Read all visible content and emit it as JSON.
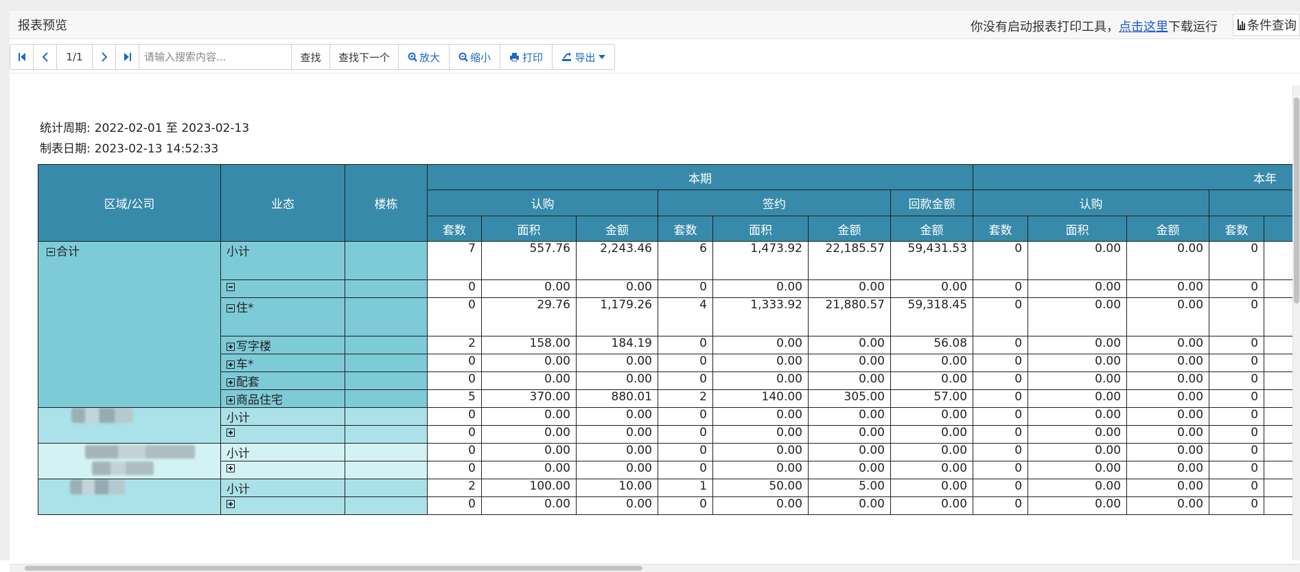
{
  "window": {
    "title": "报表预览"
  },
  "notice": {
    "text": "你没有启动报表打印工具，",
    "link": "点击这里",
    "suffix": "下载运行"
  },
  "query_button": "条件查询",
  "toolbar": {
    "page": "1/1",
    "search_placeholder": "请输入搜索内容...",
    "find": "查找",
    "find_next": "查找下一个",
    "zoom_in": "放大",
    "zoom_out": "缩小",
    "print": "打印",
    "export": "导出"
  },
  "meta": {
    "period_label": "统计周期:",
    "period_value": "2022-02-01 至 2023-02-13",
    "date_label": "制表日期:",
    "date_value": "2023-02-13 14:52:33"
  },
  "table": {
    "headers": {
      "region": "区域/公司",
      "type": "业态",
      "building": "楼栋",
      "current": "本期",
      "year": "本年",
      "subscribe": "认购",
      "sign": "签约",
      "payback": "回款金额",
      "subscribe_year": "认购",
      "sub": [
        "套数",
        "面积",
        "金额",
        "套数",
        "面积",
        "金额",
        "金额",
        "套数",
        "面积",
        "金额",
        "套数"
      ]
    },
    "group_total": "合计",
    "rows": [
      {
        "type": "小计",
        "values": [
          "7",
          "557.76",
          "2,243.46",
          "6",
          "1,473.92",
          "22,185.57",
          "59,431.53",
          "0",
          "0.00",
          "0.00",
          "0"
        ]
      },
      {
        "type": "",
        "values": [
          "0",
          "0.00",
          "0.00",
          "0",
          "0.00",
          "0.00",
          "0.00",
          "0",
          "0.00",
          "0.00",
          "0"
        ]
      },
      {
        "type": "住*",
        "values": [
          "0",
          "29.76",
          "1,179.26",
          "4",
          "1,333.92",
          "21,880.57",
          "59,318.45",
          "0",
          "0.00",
          "0.00",
          "0"
        ]
      },
      {
        "type": "写字楼",
        "values": [
          "2",
          "158.00",
          "184.19",
          "0",
          "0.00",
          "0.00",
          "56.08",
          "0",
          "0.00",
          "0.00",
          "0"
        ]
      },
      {
        "type": "车*",
        "values": [
          "0",
          "0.00",
          "0.00",
          "0",
          "0.00",
          "0.00",
          "0.00",
          "0",
          "0.00",
          "0.00",
          "0"
        ]
      },
      {
        "type": "配套",
        "values": [
          "0",
          "0.00",
          "0.00",
          "0",
          "0.00",
          "0.00",
          "0.00",
          "0",
          "0.00",
          "0.00",
          "0"
        ]
      },
      {
        "type": "商品住宅",
        "values": [
          "5",
          "370.00",
          "880.01",
          "2",
          "140.00",
          "305.00",
          "57.00",
          "0",
          "0.00",
          "0.00",
          "0"
        ]
      },
      {
        "type": "小计",
        "values": [
          "0",
          "0.00",
          "0.00",
          "0",
          "0.00",
          "0.00",
          "0.00",
          "0",
          "0.00",
          "0.00",
          "0"
        ]
      },
      {
        "type": "",
        "values": [
          "0",
          "0.00",
          "0.00",
          "0",
          "0.00",
          "0.00",
          "0.00",
          "0",
          "0.00",
          "0.00",
          "0"
        ]
      },
      {
        "type": "小计",
        "values": [
          "0",
          "0.00",
          "0.00",
          "0",
          "0.00",
          "0.00",
          "0.00",
          "0",
          "0.00",
          "0.00",
          "0"
        ]
      },
      {
        "type": "",
        "values": [
          "0",
          "0.00",
          "0.00",
          "0",
          "0.00",
          "0.00",
          "0.00",
          "0",
          "0.00",
          "0.00",
          "0"
        ]
      },
      {
        "type": "小计",
        "values": [
          "2",
          "100.00",
          "10.00",
          "1",
          "50.00",
          "5.00",
          "0.00",
          "0",
          "0.00",
          "0.00",
          "0"
        ]
      },
      {
        "type": "",
        "values": [
          "0",
          "0.00",
          "0.00",
          "0",
          "0.00",
          "0.00",
          "0.00",
          "0",
          "0.00",
          "0.00",
          "0"
        ]
      }
    ]
  },
  "colors": {
    "header": "#378aa9",
    "group1": "#7ecbd8",
    "group2": "#abe1e8",
    "group3": "#d3f2f4",
    "link": "#1a57d6",
    "toolbar_blue": "#1a68c2"
  }
}
